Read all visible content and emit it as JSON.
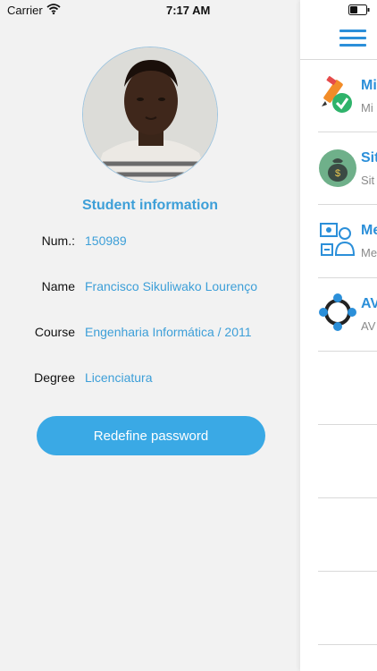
{
  "status_bar": {
    "carrier": "Carrier",
    "time": "7:17 AM",
    "wifi_icon": "wifi-icon",
    "battery_icon": "battery-icon"
  },
  "profile": {
    "section_title": "Student information",
    "rows": [
      {
        "label": "Num.:",
        "value": "150989"
      },
      {
        "label": "Name",
        "value": "Francisco Sikuliwako Lourenço"
      },
      {
        "label": "Course",
        "value": "Engenharia Informática / 2011"
      },
      {
        "label": "Degree",
        "value": "Licenciatura"
      }
    ],
    "button_label": "Redefine password"
  },
  "menu": {
    "hamburger_icon": "menu-icon",
    "items": [
      {
        "title": "Mi",
        "subtitle": "Mi",
        "icon": "pencil-check-icon"
      },
      {
        "title": "Sit",
        "subtitle": "Sit",
        "icon": "money-bag-icon"
      },
      {
        "title": "Me",
        "subtitle": "Me",
        "icon": "meeting-icon"
      },
      {
        "title": "AV",
        "subtitle": "AV",
        "icon": "network-ring-icon"
      }
    ]
  },
  "colors": {
    "accent": "#3d9fd8",
    "button": "#3aa9e5",
    "menu_blue": "#2b8fd9",
    "panel_bg": "#f2f2f2"
  }
}
